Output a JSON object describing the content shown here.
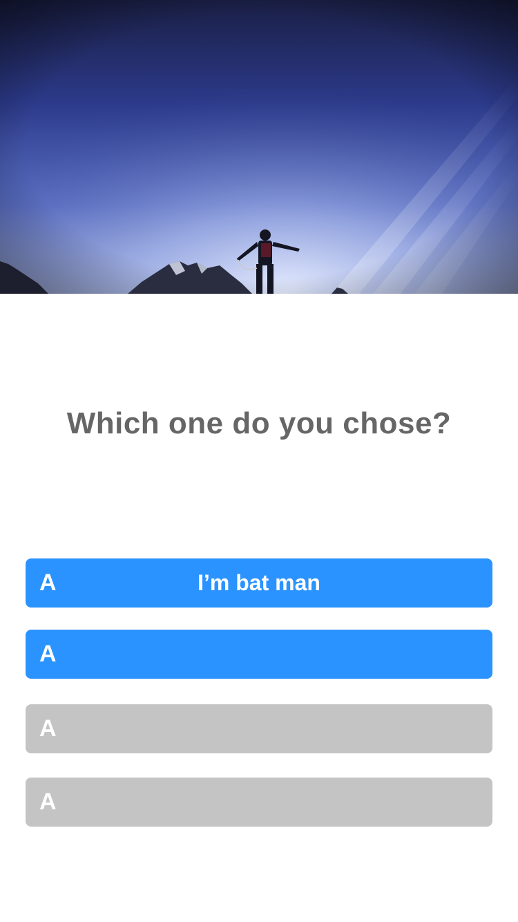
{
  "hero": {
    "image": "mountaineer-silhouette-on-peak-under-blue-sky"
  },
  "question": {
    "text": "Which one do you chose?"
  },
  "options": [
    {
      "letter": "A",
      "label": "I’m bat man",
      "state": "active"
    },
    {
      "letter": "A",
      "label": "",
      "state": "active"
    },
    {
      "letter": "A",
      "label": "",
      "state": "inactive"
    },
    {
      "letter": "A",
      "label": "",
      "state": "inactive"
    }
  ],
  "colors": {
    "active": "#2b93ff",
    "inactive": "#c4c4c4",
    "question": "#666666"
  }
}
